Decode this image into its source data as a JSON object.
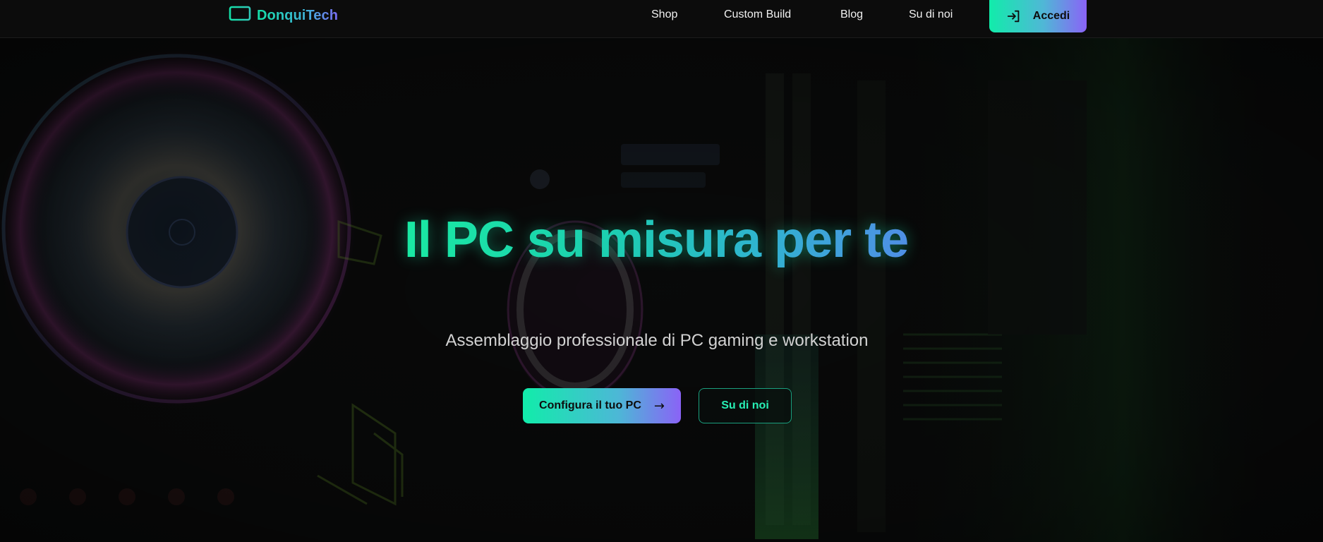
{
  "brand": {
    "name": "DonquiTech",
    "icon": "monitor-icon",
    "gradient": [
      "#14e0a8",
      "#7a6cf5"
    ]
  },
  "nav": {
    "links": [
      {
        "label": "Shop"
      },
      {
        "label": "Custom Build"
      },
      {
        "label": "Blog"
      },
      {
        "label": "Su di noi"
      }
    ],
    "login": {
      "label": "Accedi",
      "icon": "login-icon"
    }
  },
  "hero": {
    "title": "Il PC su misura per te",
    "subtitle": "Assemblaggio professionale di PC gaming e workstation",
    "primary_cta": {
      "label": "Configura il tuo PC",
      "arrow": "→"
    },
    "secondary_cta": {
      "label": "Su di noi"
    },
    "background": "dark-pc-hardware-rgb-image"
  },
  "colors": {
    "accent_green": "#11ecaa",
    "accent_purple": "#8a63f6",
    "background": "#070707"
  }
}
